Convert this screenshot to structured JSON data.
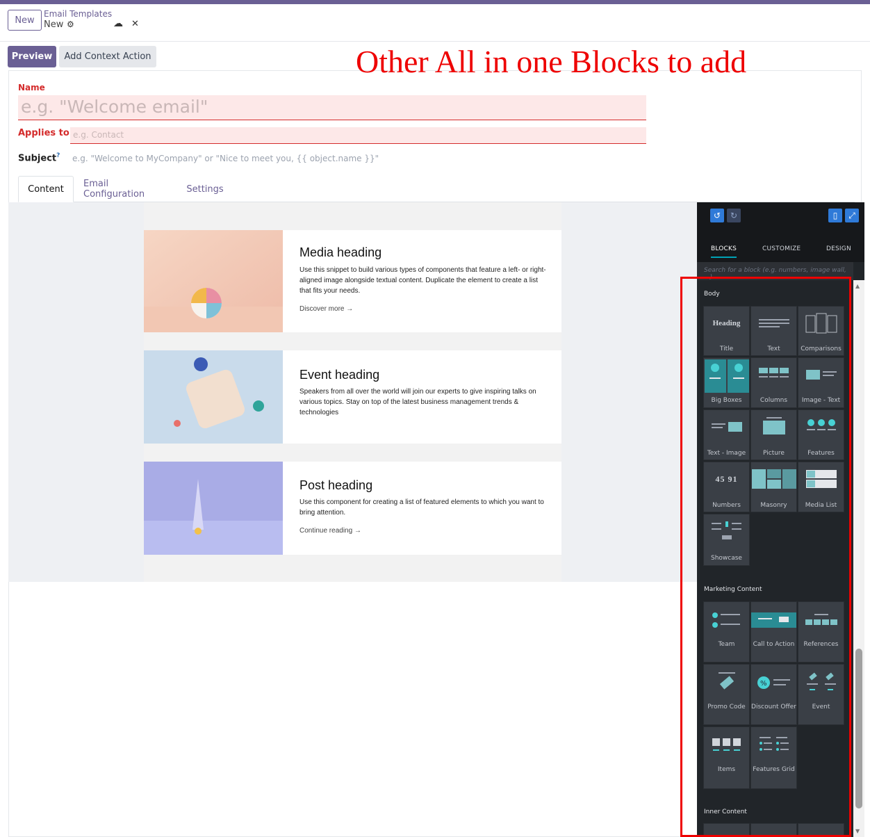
{
  "header": {
    "new_button": "New",
    "breadcrumb_parent": "Email Templates",
    "breadcrumb_current": "New"
  },
  "actions": {
    "preview": "Preview",
    "add_context_action": "Add Context Action"
  },
  "annotation": "Other All in one Blocks to add",
  "form": {
    "name_label": "Name",
    "name_placeholder": "e.g. \"Welcome email\"",
    "applies_label": "Applies to",
    "applies_placeholder": "e.g. Contact",
    "subject_label": "Subject",
    "subject_help": "?",
    "subject_placeholder": "e.g. \"Welcome to MyCompany\" or \"Nice to meet you, {{ object.name }}\""
  },
  "tabs": [
    "Content",
    "Email Configuration",
    "Settings"
  ],
  "cards": [
    {
      "heading": "Media heading",
      "body": "Use this snippet to build various types of components that feature a left- or right-aligned image alongside textual content. Duplicate the element to create a list that fits your needs.",
      "link": "Discover more →"
    },
    {
      "heading": "Event heading",
      "body": "Speakers from all over the world will join our experts to give inspiring talks on various topics. Stay on top of the latest business management trends & technologies",
      "link": ""
    },
    {
      "heading": "Post heading",
      "body": "Use this component for creating a list of featured elements to which you want to bring attention.",
      "link": "Continue reading →"
    }
  ],
  "panel": {
    "tabs": [
      "BLOCKS",
      "CUSTOMIZE",
      "DESIGN"
    ],
    "search_placeholder": "Search for a block (e.g. numbers, image wall, ...)",
    "sections": {
      "body": "Body",
      "marketing": "Marketing Content",
      "inner": "Inner Content"
    },
    "body_blocks": [
      "Title",
      "Text",
      "Comparisons",
      "Big Boxes",
      "Columns",
      "Image - Text",
      "Text - Image",
      "Picture",
      "Features",
      "Numbers",
      "Masonry",
      "Media List",
      "Showcase"
    ],
    "marketing_blocks": [
      "Team",
      "Call to Action",
      "References",
      "Promo Code",
      "Discount Offer",
      "Event",
      "Items",
      "Features Grid"
    ],
    "title_icon_text": "Heading",
    "numbers_icon_text": "45 91"
  },
  "colors": {
    "brand": "#6a5f94",
    "danger": "#d42b2b",
    "accent": "#00a3b7",
    "annotation": "#ee0000"
  }
}
